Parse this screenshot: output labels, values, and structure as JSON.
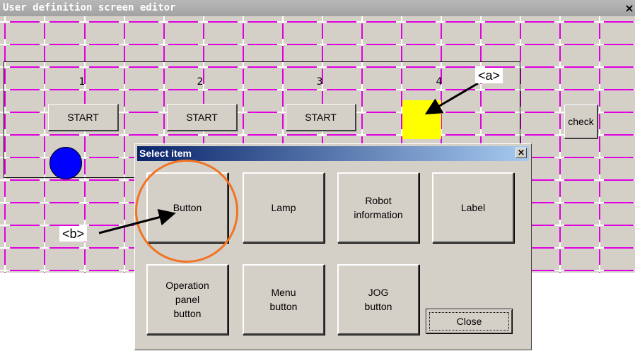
{
  "editor": {
    "title": "User definition screen editor",
    "close_label": "×",
    "panel": {
      "columns": [
        "1",
        "2",
        "3",
        "4"
      ],
      "buttons": [
        "START",
        "START",
        "START"
      ],
      "check_label": "check"
    }
  },
  "callouts": {
    "a": "<a>",
    "b": "<b>"
  },
  "dialog": {
    "title": "Select item",
    "close_label": "×",
    "items": [
      "Button",
      "Lamp",
      "Robot\ninformation",
      "Label",
      "Operation\npanel\nbutton",
      "Menu\nbutton",
      "JOG\nbutton"
    ],
    "close_button": "Close"
  },
  "colors": {
    "grid_magenta": "#e000e0",
    "lamp_blue": "#0000ff",
    "highlight_yellow": "#ffff00",
    "highlight_orange": "#f27321"
  }
}
